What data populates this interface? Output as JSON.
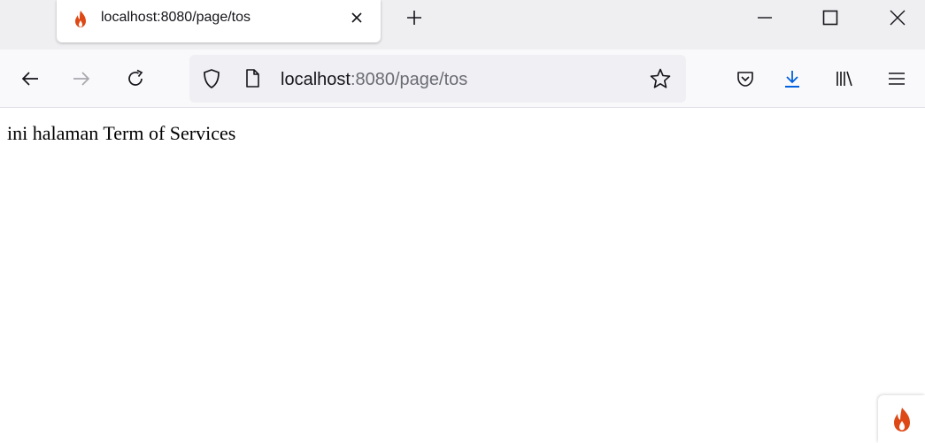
{
  "tab": {
    "title": "localhost:8080/page/tos",
    "favicon": "flame-icon",
    "favicon_color": "#dd4814"
  },
  "window_controls": {
    "minimize": "minimize-icon",
    "maximize": "maximize-icon",
    "close": "close-icon"
  },
  "toolbar": {
    "back": "arrow-left-icon",
    "forward": "arrow-right-icon",
    "reload": "reload-icon",
    "pocket": "pocket-icon",
    "downloads": "download-icon",
    "downloads_color": "#0060df",
    "library": "library-icon",
    "menu": "hamburger-icon"
  },
  "urlbar": {
    "host": "localhost",
    "path": ":8080/page/tos",
    "shield": "shield-icon",
    "page": "page-icon",
    "bookmark": "star-icon"
  },
  "page": {
    "text": "ini halaman Term of Services"
  },
  "debug_toolbar": {
    "icon": "flame-icon"
  }
}
